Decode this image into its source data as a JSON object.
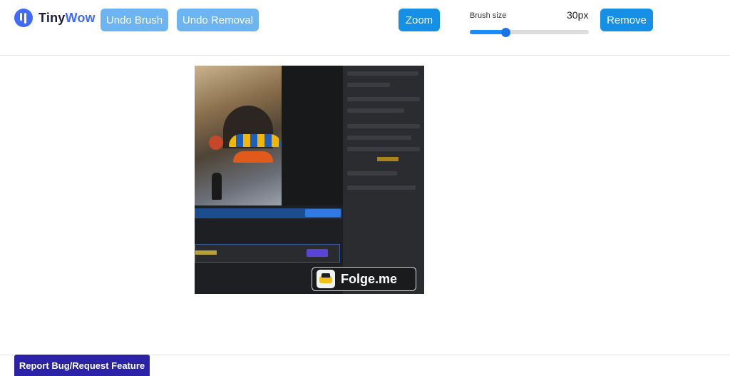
{
  "app": {
    "logo_prefix": "Tiny",
    "logo_suffix": "Wow",
    "brand_color": "#3f6bff"
  },
  "toolbar": {
    "undo_brush_label": "Undo Brush",
    "undo_removal_label": "Undo Removal",
    "zoom_label": "Zoom",
    "brush_size_label": "Brush size",
    "brush_size_value": "30px",
    "brush_size_level": 0.3,
    "remove_label": "Remove"
  },
  "canvas": {
    "watermark_text": "Folge.me"
  },
  "footer": {
    "report_label": "Report Bug/Request Feature"
  },
  "colors": {
    "light_button": "#6db4f2",
    "solid_button": "#1590e6",
    "report_button": "#2b22a8"
  }
}
